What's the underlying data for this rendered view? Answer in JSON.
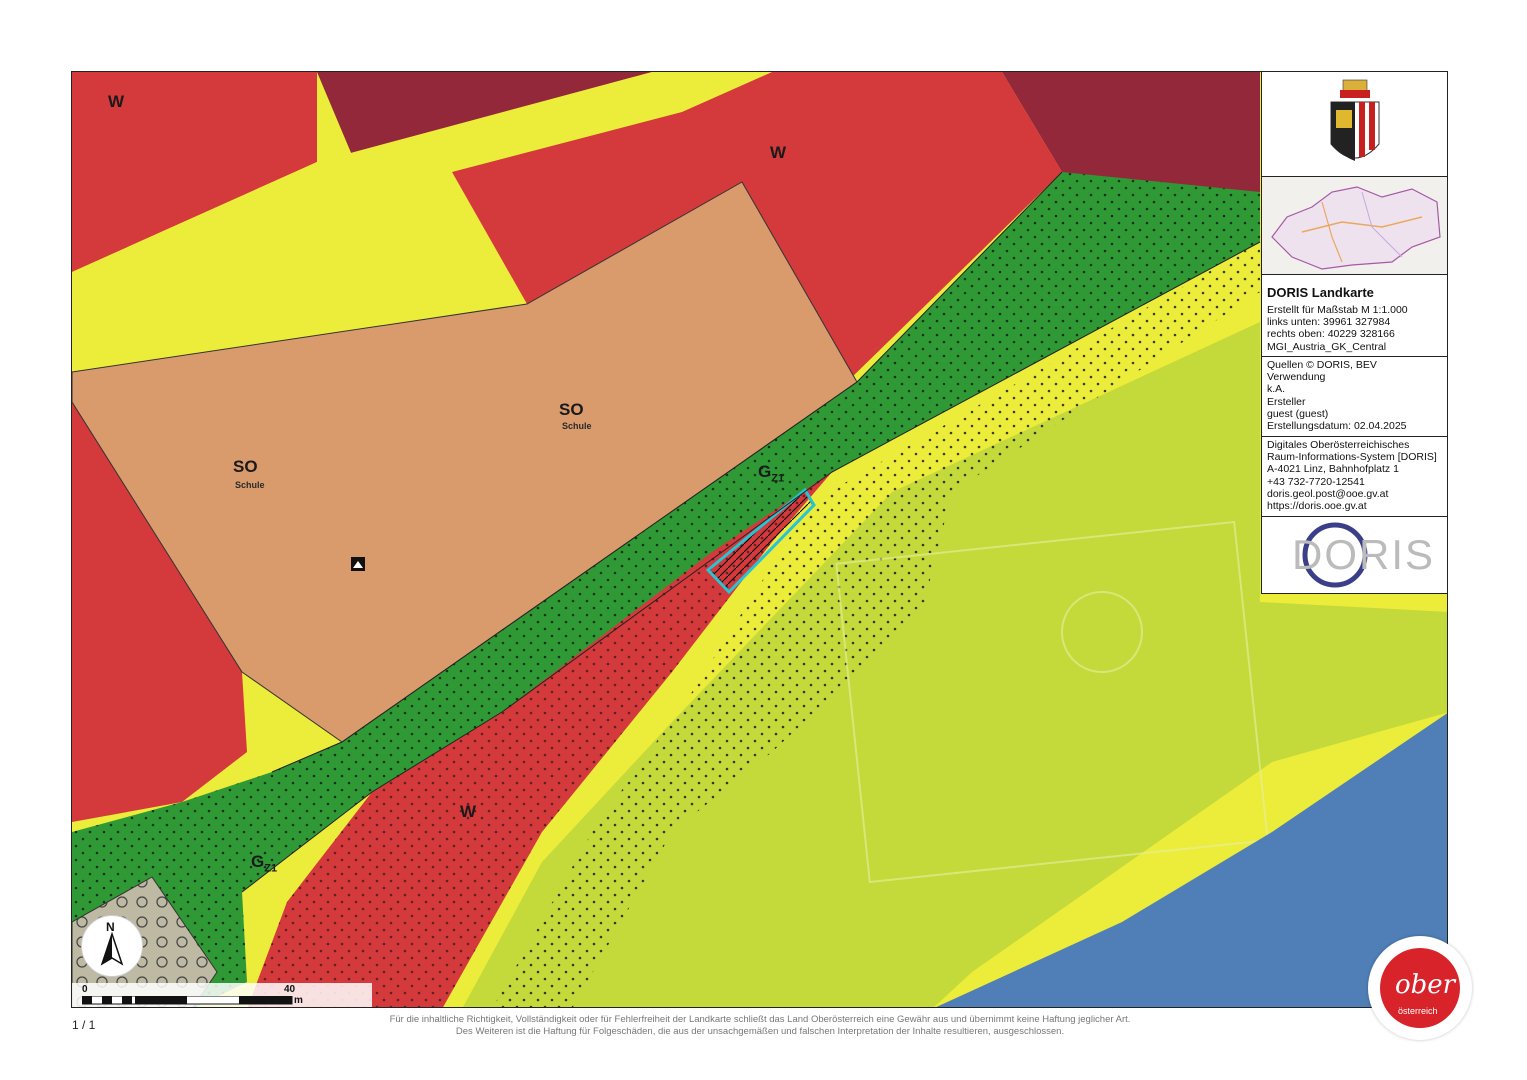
{
  "map": {
    "zones": [
      {
        "code": "W"
      },
      {
        "code": "W"
      },
      {
        "code": "SO",
        "sub": "Schule"
      },
      {
        "code": "SO",
        "sub": "Schule"
      },
      {
        "code": "W"
      }
    ],
    "gz_labels": [
      {
        "main": "G",
        "sub": "Z1"
      },
      {
        "main": "G",
        "sub": "Z1"
      }
    ],
    "colors": {
      "residential": "#d4393c",
      "residential_dark": "#93283a",
      "school": "#d99a6c",
      "green": "#2f9a35",
      "road": "#ecec3a",
      "sport": "#c4d93a",
      "water": "#4f7fb6",
      "parcel": "#27c4d4"
    }
  },
  "panel": {
    "title": "DORIS Landkarte",
    "scale_lines": [
      "Erstellt für Maßstab M 1:1.000",
      "links unten: 39961 327984",
      "rechts oben: 40229 328166",
      "MGI_Austria_GK_Central"
    ],
    "meta_lines": [
      "Quellen © DORIS, BEV",
      "Verwendung",
      "k.A.",
      "Ersteller",
      "guest (guest)",
      "Erstellungsdatum: 02.04.2025"
    ],
    "contact_lines": [
      "Digitales Oberösterreichisches",
      "Raum-Informations-System [DORIS]",
      "A-4021 Linz, Bahnhofplatz 1",
      "+43 732-7720-12541",
      "doris.geol.post@ooe.gv.at",
      "https://doris.ooe.gv.at"
    ],
    "logo_text": "DORIS"
  },
  "scalebar": {
    "start": "0",
    "end": "40",
    "unit": "m"
  },
  "north": "N",
  "page_number": "1 / 1",
  "disclaimer": [
    "Für die inhaltliche Richtigkeit, Vollständigkeit oder für Fehlerfreiheit der Landkarte schließt das Land Oberösterreich eine Gewähr aus und übernimmt keine Haftung jeglicher Art.",
    "Des Weiteren ist die Haftung für Folgeschäden, die aus der unsachgemäßen und falschen Interpretation der Inhalte resultieren, ausgeschlossen."
  ],
  "brand_logo": {
    "top": "ober",
    "bottom": "österreich"
  }
}
